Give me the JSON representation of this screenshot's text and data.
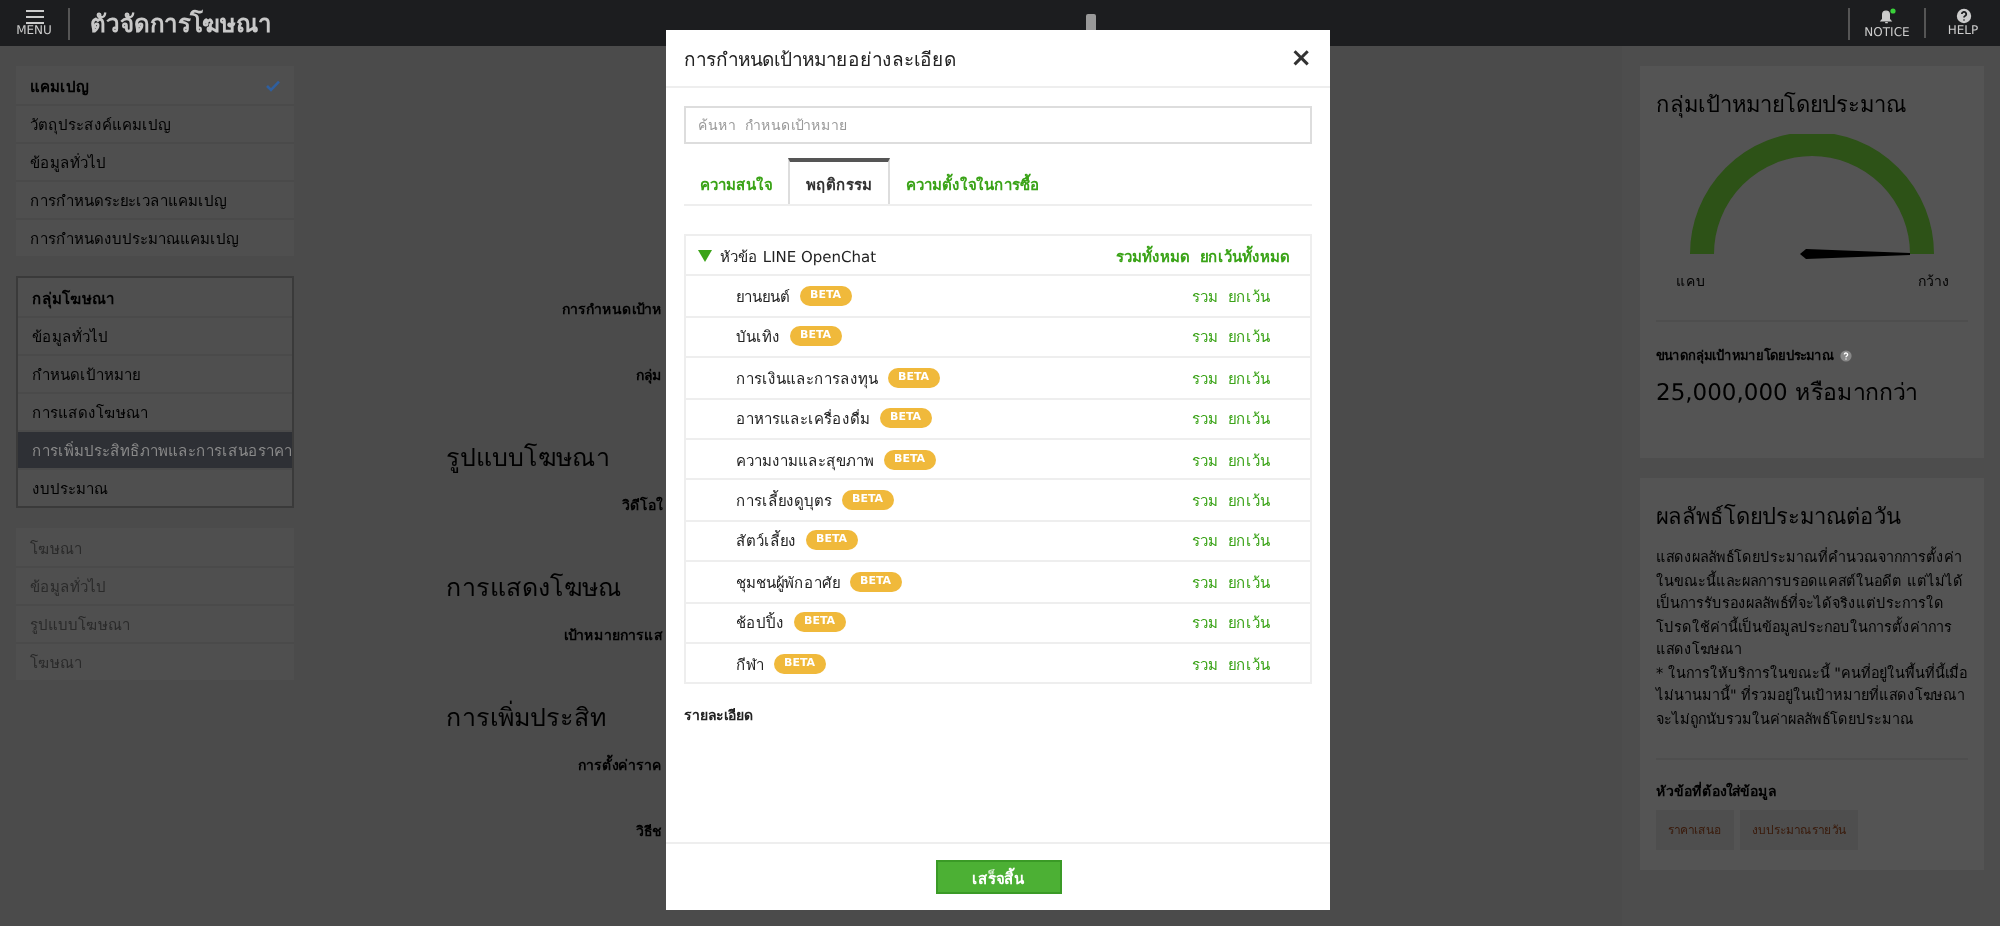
{
  "top_bar": {
    "menu_label": "MENU",
    "title": "ตัวจัดการโฆษณา",
    "notice_label": "NOTICE",
    "notice_unread": true,
    "help_label": "HELP"
  },
  "sidebar": {
    "sections": [
      {
        "title": "แคมเปญ",
        "checked": true,
        "disabled": false,
        "items": [
          {
            "label": "วัตถุประสงค์แคมเปญ",
            "selected": false
          },
          {
            "label": "ข้อมูลทั่วไป",
            "selected": false
          },
          {
            "label": "การกำหนดระยะเวลาแคมเปญ",
            "selected": false
          },
          {
            "label": "การกำหนดงบประมาณแคมเปญ",
            "selected": false
          }
        ]
      },
      {
        "title": "กลุ่มโฆษณา",
        "checked": false,
        "disabled": false,
        "items": [
          {
            "label": "ข้อมูลทั่วไป",
            "selected": false
          },
          {
            "label": "กำหนดเป้าหมาย",
            "selected": false
          },
          {
            "label": "การแสดงโฆษณา",
            "selected": false
          },
          {
            "label": "การเพิ่มประสิทธิภาพและการเสนอราคา",
            "selected": true
          },
          {
            "label": "งบประมาณ",
            "selected": false
          }
        ]
      },
      {
        "title": "โฆษณา",
        "checked": false,
        "disabled": true,
        "items": [
          {
            "label": "ข้อมูลทั่วไป",
            "selected": false
          },
          {
            "label": "รูปแบบโฆษณา",
            "selected": false
          },
          {
            "label": "โฆษณา",
            "selected": false
          }
        ]
      }
    ]
  },
  "main": {
    "items": [
      {
        "kind": "label",
        "text": "การกำหนดเป้าห"
      },
      {
        "kind": "label",
        "text": "กลุ่ม"
      },
      {
        "kind": "heading",
        "text": "รูปแบบโฆษณา"
      },
      {
        "kind": "label",
        "text": "วิดีโอใ"
      },
      {
        "kind": "heading",
        "text": "การแสดงโฆษณ"
      },
      {
        "kind": "label",
        "text": "เป้าหมายการแส"
      },
      {
        "kind": "heading",
        "text": "การเพิ่มประสิท"
      },
      {
        "kind": "label",
        "text": "การตั้งค่าราค"
      },
      {
        "kind": "label",
        "text": "วิธีช"
      }
    ]
  },
  "modal": {
    "title": "การกำหนดเป้าหมายอย่างละเอียด",
    "close": "×",
    "search": {
      "placeholder": "ค้นหา  กำหนดเป้าหมาย"
    },
    "tabs": [
      {
        "label": "ความสนใจ",
        "selected": false
      },
      {
        "label": "พฤติกรรม",
        "selected": true
      },
      {
        "label": "ความตั้งใจในการซื้อ",
        "selected": false
      }
    ],
    "category": {
      "title": "หัวข้อ LINE OpenChat",
      "expanded": true,
      "include_all": "รวมทั้งหมด",
      "exclude_all": "ยกเว้นทั้งหมด",
      "items": [
        {
          "name": "ยานยนต์",
          "badge": "BETA",
          "include": "รวม",
          "exclude": "ยกเว้น"
        },
        {
          "name": "บันเทิง",
          "badge": "BETA",
          "include": "รวม",
          "exclude": "ยกเว้น"
        },
        {
          "name": "การเงินและการลงทุน",
          "badge": "BETA",
          "include": "รวม",
          "exclude": "ยกเว้น"
        },
        {
          "name": "อาหารและเครื่องดื่ม",
          "badge": "BETA",
          "include": "รวม",
          "exclude": "ยกเว้น"
        },
        {
          "name": "ความงามและสุขภาพ",
          "badge": "BETA",
          "include": "รวม",
          "exclude": "ยกเว้น"
        },
        {
          "name": "การเลี้ยงดูบุตร",
          "badge": "BETA",
          "include": "รวม",
          "exclude": "ยกเว้น"
        },
        {
          "name": "สัตว์เลี้ยง",
          "badge": "BETA",
          "include": "รวม",
          "exclude": "ยกเว้น"
        },
        {
          "name": "ชุมชนผู้พักอาศัย",
          "badge": "BETA",
          "include": "รวม",
          "exclude": "ยกเว้น"
        },
        {
          "name": "ช้อปปิ้ง",
          "badge": "BETA",
          "include": "รวม",
          "exclude": "ยกเว้น"
        },
        {
          "name": "กีฬา",
          "badge": "BETA",
          "include": "รวม",
          "exclude": "ยกเว้น"
        }
      ]
    },
    "details_label": "รายละเอียด",
    "done_button": "เสร็จสิ้น"
  },
  "right_panel": {
    "audience": {
      "title": "กลุ่มเป้าหมายโดยประมาณ",
      "min_label": "แคบ",
      "max_label": "กว้าง",
      "size_label": "ขนาดกลุ่มเป้าหมายโดยประมาณ",
      "size_value": "25,000,000 หรือมากกว่า"
    },
    "results": {
      "title": "ผลลัพธ์โดยประมาณต่อวัน",
      "description": "แสดงผลลัพธ์โดยประมาณที่คำนวณจากการตั้งค่าในขณะนี้และผลการบรอดแคสต์ในอดีต แต่ไม่ได้เป็นการรับรองผลลัพธ์ที่จะได้จริงแต่ประการใด โปรดใช้ค่านี้เป็นข้อมูลประกอบในการตั้งค่าการแสดงโฆษณา",
      "note": "* ในการให้บริการในขณะนี้ \"คนที่อยู่ในพื้นที่นี้เมื่อไม่นานมานี้\" ที่รวมอยู่ในเป้าหมายที่แสดงโฆษณาจะไม่ถูกนับรวมในค่าผลลัพธ์โดยประมาณ",
      "required_title": "หัวข้อที่ต้องใส่ข้อมูล",
      "required_tags": [
        "ราคาเสนอ",
        "งบประมาณรายวัน"
      ]
    }
  }
}
